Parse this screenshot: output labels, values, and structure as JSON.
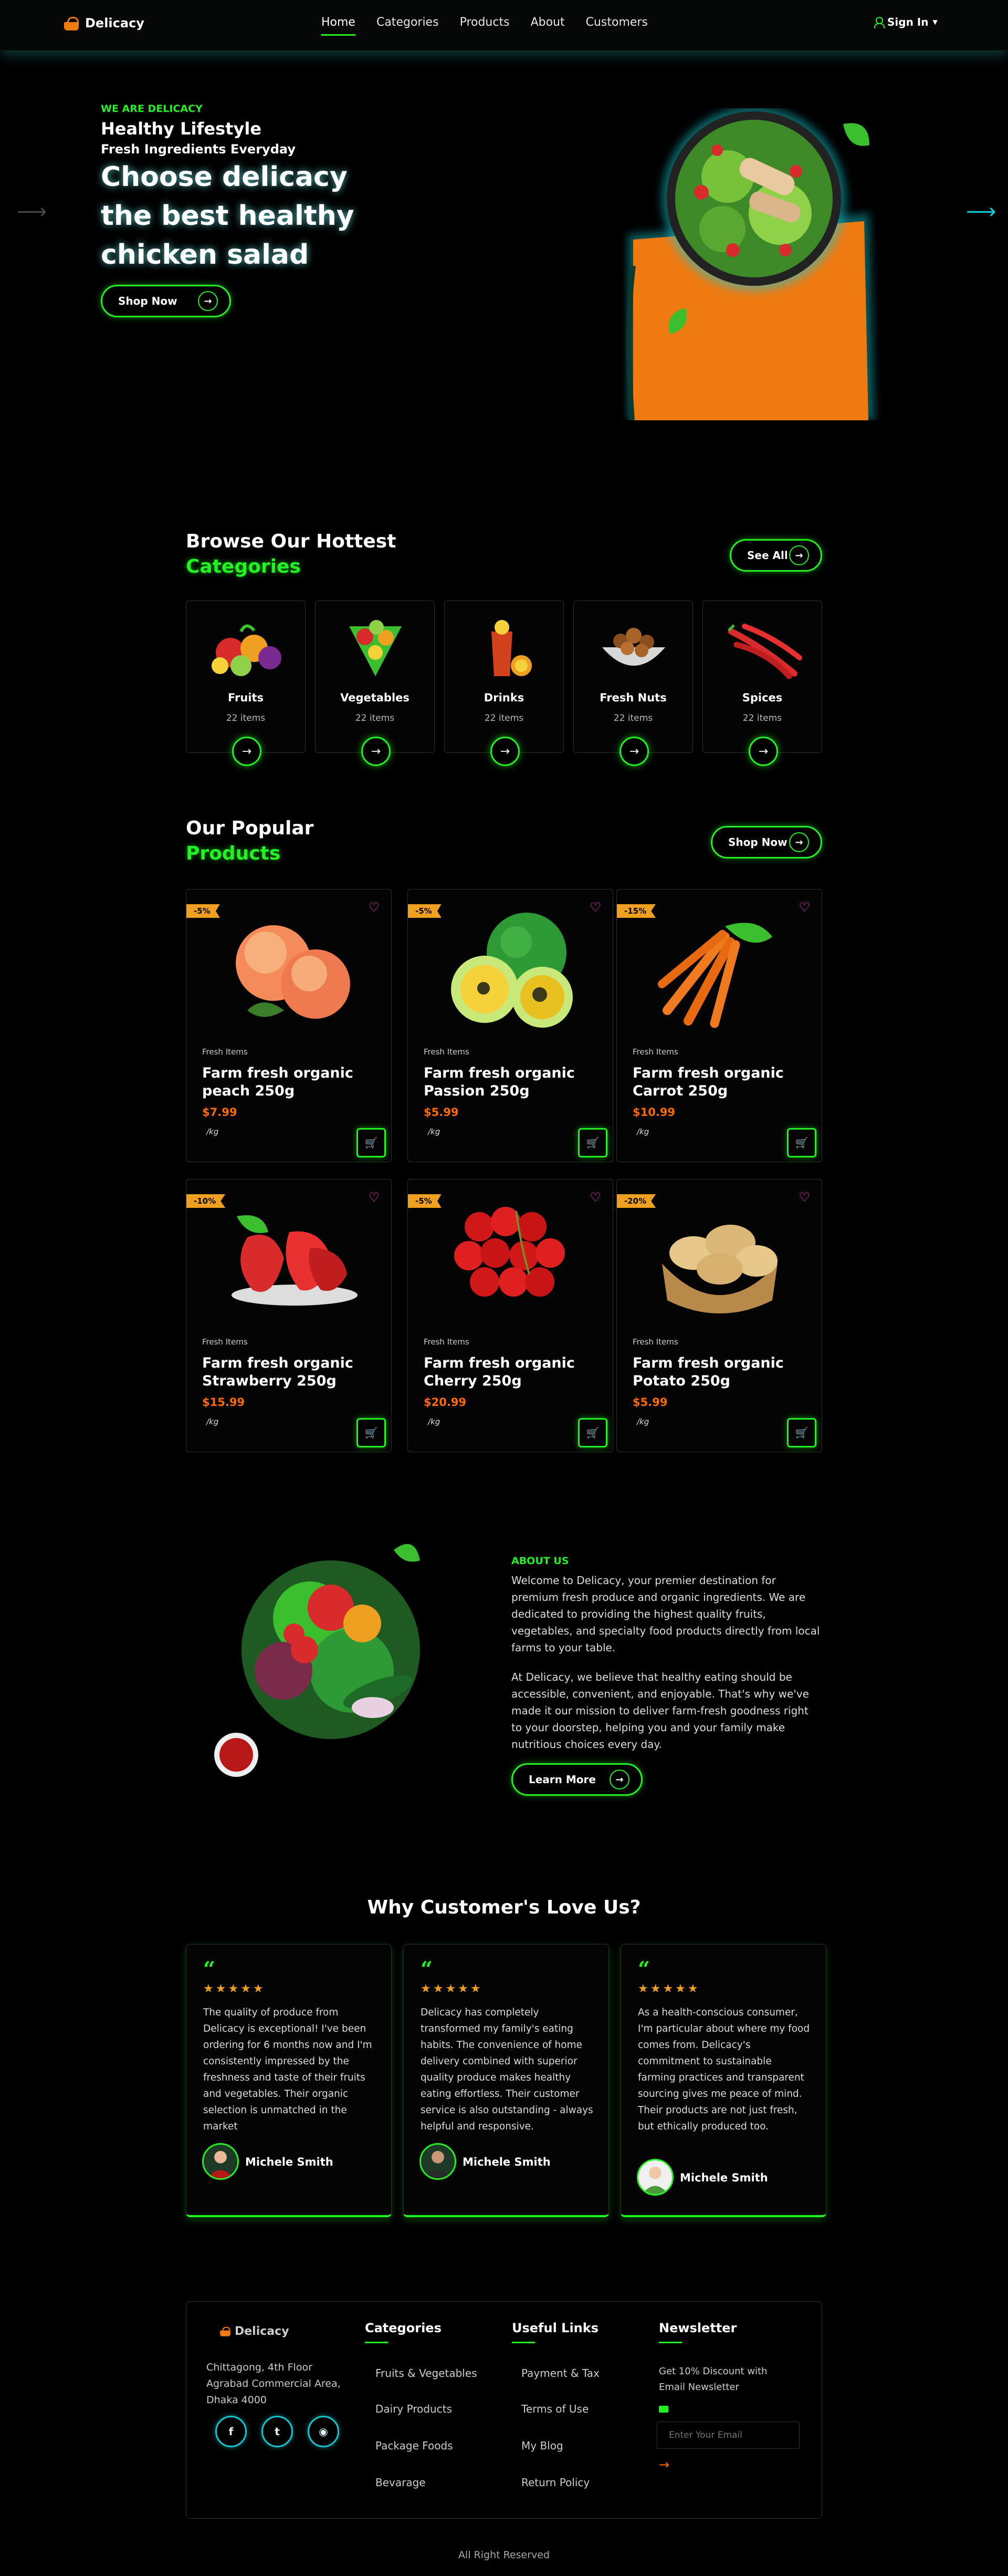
{
  "nav": {
    "brand": "Delicacy",
    "items": [
      "Home",
      "Categories",
      "Products",
      "About",
      "Customers"
    ],
    "active": "Home",
    "signin": "Sign In"
  },
  "hero": {
    "tag": "WE ARE DELICACY",
    "line1": "Healthy Lifestyle",
    "line2": "Fresh Ingredients Everyday",
    "headline": "Choose delicacy the best healthy chicken salad",
    "button": "Shop Now"
  },
  "categories": {
    "title1": "Browse Our Hottest",
    "title2": "Categories",
    "see_all": "See All",
    "items": [
      {
        "name": "Fruits",
        "count": "22 items"
      },
      {
        "name": "Vegetables",
        "count": "22 items"
      },
      {
        "name": "Drinks",
        "count": "22 items"
      },
      {
        "name": "Fresh Nuts",
        "count": "22 items"
      },
      {
        "name": "Spices",
        "count": "22 items"
      }
    ]
  },
  "products": {
    "title1": "Our Popular",
    "title2": "Products",
    "shop_now": "Shop Now",
    "items": [
      {
        "badge": "-5%",
        "category": "Fresh Items",
        "title": "Farm fresh organic peach 250g",
        "price": "$7.99",
        "unit": "/kg"
      },
      {
        "badge": "-5%",
        "category": "Fresh Items",
        "title": "Farm fresh organic Passion 250g",
        "price": "$5.99",
        "unit": "/kg"
      },
      {
        "badge": "-15%",
        "category": "Fresh Items",
        "title": "Farm fresh organic Carrot 250g",
        "price": "$10.99",
        "unit": "/kg"
      },
      {
        "badge": "-10%",
        "category": "Fresh Items",
        "title": "Farm fresh organic Strawberry 250g",
        "price": "$15.99",
        "unit": "/kg"
      },
      {
        "badge": "-5%",
        "category": "Fresh Items",
        "title": "Farm fresh organic Cherry 250g",
        "price": "$20.99",
        "unit": "/kg"
      },
      {
        "badge": "-20%",
        "category": "Fresh Items",
        "title": "Farm fresh organic Potato 250g",
        "price": "$5.99",
        "unit": "/kg"
      }
    ]
  },
  "about": {
    "tag": "ABOUT US",
    "p1": "Welcome to Delicacy, your premier destination for premium fresh produce and organic ingredients. We are dedicated to providing the highest quality fruits, vegetables, and specialty food products directly from local farms to your table.",
    "p2": "At Delicacy, we believe that healthy eating should be accessible, convenient, and enjoyable. That's why we've made it our mission to deliver farm-fresh goodness right to your doorstep, helping you and your family make nutritious choices every day.",
    "button": "Learn More"
  },
  "testimonials": {
    "title": "Why Customer's Love Us?",
    "items": [
      {
        "text": "The quality of produce from Delicacy is exceptional! I've been ordering for 6 months now and I'm consistently impressed by the freshness and taste of their fruits and vegetables. Their organic selection is unmatched in the market",
        "name": "Michele Smith"
      },
      {
        "text": "Delicacy has completely transformed my family's eating habits. The convenience of home delivery combined with superior quality produce makes healthy eating effortless. Their customer service is also outstanding - always helpful and responsive.",
        "name": "Michele Smith"
      },
      {
        "text": "As a health-conscious consumer, I'm particular about where my food comes from. Delicacy's commitment to sustainable farming practices and transparent sourcing gives me peace of mind. Their products are not just fresh, but ethically produced too.",
        "name": "Michele Smith"
      }
    ]
  },
  "footer": {
    "brand": "Delicacy",
    "address": "Chittagong, 4th Floor Agrabad Commercial Area, Dhaka 4000",
    "categories_title": "Categories",
    "categories": [
      "Fruits & Vegetables",
      "Dairy Products",
      "Package Foods",
      "Bevarage"
    ],
    "links_title": "Useful Links",
    "links": [
      "Payment & Tax",
      "Terms of Use",
      "My Blog",
      "Return Policy"
    ],
    "newsletter_title": "Newsletter",
    "newsletter_text": "Get 10% Discount with Email Newsletter",
    "email_placeholder": "Enter Your Email",
    "copyright": "All Right Reserved"
  }
}
